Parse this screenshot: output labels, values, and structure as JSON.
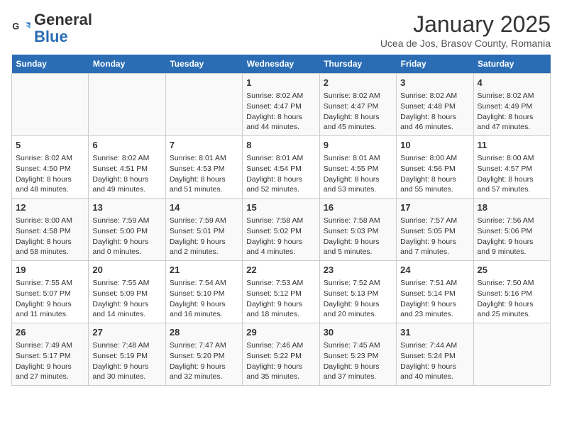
{
  "logo": {
    "line1": "General",
    "line2": "Blue"
  },
  "title": "January 2025",
  "location": "Ucea de Jos, Brasov County, Romania",
  "days_of_week": [
    "Sunday",
    "Monday",
    "Tuesday",
    "Wednesday",
    "Thursday",
    "Friday",
    "Saturday"
  ],
  "weeks": [
    [
      {
        "day": "",
        "content": ""
      },
      {
        "day": "",
        "content": ""
      },
      {
        "day": "",
        "content": ""
      },
      {
        "day": "1",
        "content": "Sunrise: 8:02 AM\nSunset: 4:47 PM\nDaylight: 8 hours\nand 44 minutes."
      },
      {
        "day": "2",
        "content": "Sunrise: 8:02 AM\nSunset: 4:47 PM\nDaylight: 8 hours\nand 45 minutes."
      },
      {
        "day": "3",
        "content": "Sunrise: 8:02 AM\nSunset: 4:48 PM\nDaylight: 8 hours\nand 46 minutes."
      },
      {
        "day": "4",
        "content": "Sunrise: 8:02 AM\nSunset: 4:49 PM\nDaylight: 8 hours\nand 47 minutes."
      }
    ],
    [
      {
        "day": "5",
        "content": "Sunrise: 8:02 AM\nSunset: 4:50 PM\nDaylight: 8 hours\nand 48 minutes."
      },
      {
        "day": "6",
        "content": "Sunrise: 8:02 AM\nSunset: 4:51 PM\nDaylight: 8 hours\nand 49 minutes."
      },
      {
        "day": "7",
        "content": "Sunrise: 8:01 AM\nSunset: 4:53 PM\nDaylight: 8 hours\nand 51 minutes."
      },
      {
        "day": "8",
        "content": "Sunrise: 8:01 AM\nSunset: 4:54 PM\nDaylight: 8 hours\nand 52 minutes."
      },
      {
        "day": "9",
        "content": "Sunrise: 8:01 AM\nSunset: 4:55 PM\nDaylight: 8 hours\nand 53 minutes."
      },
      {
        "day": "10",
        "content": "Sunrise: 8:00 AM\nSunset: 4:56 PM\nDaylight: 8 hours\nand 55 minutes."
      },
      {
        "day": "11",
        "content": "Sunrise: 8:00 AM\nSunset: 4:57 PM\nDaylight: 8 hours\nand 57 minutes."
      }
    ],
    [
      {
        "day": "12",
        "content": "Sunrise: 8:00 AM\nSunset: 4:58 PM\nDaylight: 8 hours\nand 58 minutes."
      },
      {
        "day": "13",
        "content": "Sunrise: 7:59 AM\nSunset: 5:00 PM\nDaylight: 9 hours\nand 0 minutes."
      },
      {
        "day": "14",
        "content": "Sunrise: 7:59 AM\nSunset: 5:01 PM\nDaylight: 9 hours\nand 2 minutes."
      },
      {
        "day": "15",
        "content": "Sunrise: 7:58 AM\nSunset: 5:02 PM\nDaylight: 9 hours\nand 4 minutes."
      },
      {
        "day": "16",
        "content": "Sunrise: 7:58 AM\nSunset: 5:03 PM\nDaylight: 9 hours\nand 5 minutes."
      },
      {
        "day": "17",
        "content": "Sunrise: 7:57 AM\nSunset: 5:05 PM\nDaylight: 9 hours\nand 7 minutes."
      },
      {
        "day": "18",
        "content": "Sunrise: 7:56 AM\nSunset: 5:06 PM\nDaylight: 9 hours\nand 9 minutes."
      }
    ],
    [
      {
        "day": "19",
        "content": "Sunrise: 7:55 AM\nSunset: 5:07 PM\nDaylight: 9 hours\nand 11 minutes."
      },
      {
        "day": "20",
        "content": "Sunrise: 7:55 AM\nSunset: 5:09 PM\nDaylight: 9 hours\nand 14 minutes."
      },
      {
        "day": "21",
        "content": "Sunrise: 7:54 AM\nSunset: 5:10 PM\nDaylight: 9 hours\nand 16 minutes."
      },
      {
        "day": "22",
        "content": "Sunrise: 7:53 AM\nSunset: 5:12 PM\nDaylight: 9 hours\nand 18 minutes."
      },
      {
        "day": "23",
        "content": "Sunrise: 7:52 AM\nSunset: 5:13 PM\nDaylight: 9 hours\nand 20 minutes."
      },
      {
        "day": "24",
        "content": "Sunrise: 7:51 AM\nSunset: 5:14 PM\nDaylight: 9 hours\nand 23 minutes."
      },
      {
        "day": "25",
        "content": "Sunrise: 7:50 AM\nSunset: 5:16 PM\nDaylight: 9 hours\nand 25 minutes."
      }
    ],
    [
      {
        "day": "26",
        "content": "Sunrise: 7:49 AM\nSunset: 5:17 PM\nDaylight: 9 hours\nand 27 minutes."
      },
      {
        "day": "27",
        "content": "Sunrise: 7:48 AM\nSunset: 5:19 PM\nDaylight: 9 hours\nand 30 minutes."
      },
      {
        "day": "28",
        "content": "Sunrise: 7:47 AM\nSunset: 5:20 PM\nDaylight: 9 hours\nand 32 minutes."
      },
      {
        "day": "29",
        "content": "Sunrise: 7:46 AM\nSunset: 5:22 PM\nDaylight: 9 hours\nand 35 minutes."
      },
      {
        "day": "30",
        "content": "Sunrise: 7:45 AM\nSunset: 5:23 PM\nDaylight: 9 hours\nand 37 minutes."
      },
      {
        "day": "31",
        "content": "Sunrise: 7:44 AM\nSunset: 5:24 PM\nDaylight: 9 hours\nand 40 minutes."
      },
      {
        "day": "",
        "content": ""
      }
    ]
  ]
}
